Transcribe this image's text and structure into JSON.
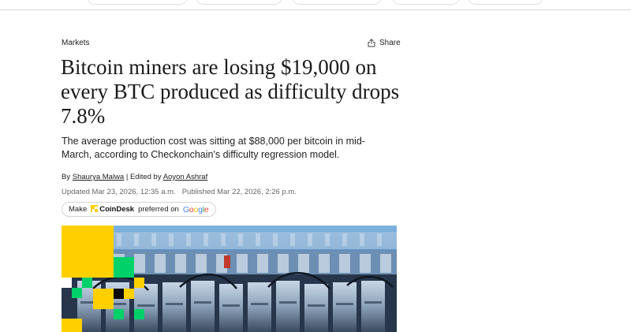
{
  "article": {
    "category": "Markets",
    "share_label": "Share",
    "headline": "Bitcoin miners are losing $19,000 on every BTC produced as difficulty drops 7.8%",
    "dek": "The average production cost was sitting at $88,000 per bitcoin in mid-March, according to Checkonchain's difficulty regression model.",
    "byline": {
      "by_prefix": "By",
      "author": "Shaurya Malwa",
      "edited_prefix": "| Edited by",
      "editor": "Aoyon Ashraf"
    },
    "updated": "Updated Mar 23, 2026, 12:35 a.m.",
    "published": "Published Mar 22, 2026, 2:26 p.m.",
    "preferred": {
      "make": "Make",
      "brand": "CoinDesk",
      "preferred_on": "preferred on",
      "google": [
        "G",
        "o",
        "o",
        "g",
        "l",
        "e"
      ]
    }
  },
  "colors": {
    "google": [
      "#4285F4",
      "#EA4335",
      "#FBBC05",
      "#4285F4",
      "#34A853",
      "#EA4335"
    ],
    "coindesk_yellow": "#FFD000",
    "coindesk_green": "#00D26A"
  },
  "icons": [
    "share-icon",
    "coindesk-logo-icon"
  ]
}
